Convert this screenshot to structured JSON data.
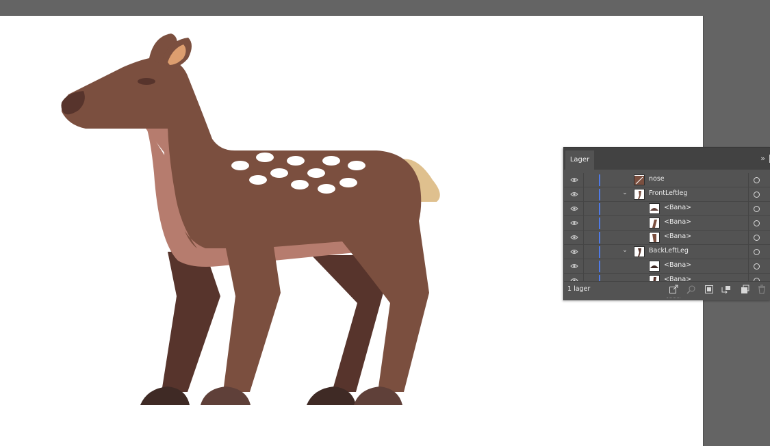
{
  "colors": {
    "canvas_bg": "#646464",
    "artboard": "#ffffff",
    "deer_body": "#7b4f3f",
    "deer_belly": "#b67c6e",
    "deer_back_legs": "#57342c",
    "deer_hoof_front": "#5f4039",
    "deer_hoof_back": "#3f2a25",
    "deer_tail": "#dfc08e",
    "deer_ear_inner": "#dd9e6f",
    "deer_spots": "#ffffff",
    "layer_color_bar": "#4f7ae6"
  },
  "layers_panel": {
    "tab_label": "Lager",
    "menu_icon": "double-chevron-right-icon",
    "rows": [
      {
        "name": "nose",
        "kind": "path",
        "expanded": null,
        "visible": true
      },
      {
        "name": "FrontLeftleg",
        "kind": "group",
        "expanded": true,
        "visible": true
      },
      {
        "name": "<Bana>",
        "kind": "path",
        "expanded": null,
        "visible": true
      },
      {
        "name": "<Bana>",
        "kind": "path",
        "expanded": null,
        "visible": true
      },
      {
        "name": "<Bana>",
        "kind": "path",
        "expanded": null,
        "visible": true
      },
      {
        "name": "BackLeftLeg",
        "kind": "group",
        "expanded": true,
        "visible": true
      },
      {
        "name": "<Bana>",
        "kind": "path",
        "expanded": null,
        "visible": true
      },
      {
        "name": "<Bana>",
        "kind": "path",
        "expanded": null,
        "visible": true
      }
    ],
    "footer": {
      "layer_count": "1 lager",
      "icons": [
        "export-icon",
        "locate-object-icon",
        "clipping-mask-icon",
        "new-sublayer-icon",
        "new-layer-icon",
        "delete-icon"
      ]
    }
  }
}
